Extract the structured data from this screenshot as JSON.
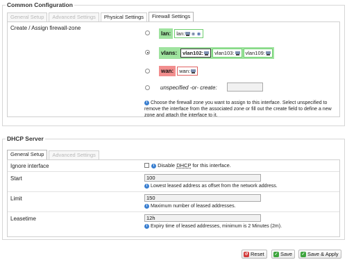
{
  "common": {
    "legend": "Common Configuration",
    "tabs": [
      "General Setup",
      "Advanced Settings",
      "Physical Settings",
      "Firewall Settings"
    ],
    "active_tab": "Firewall Settings",
    "field_label": "Create / Assign firewall-zone",
    "zones": [
      {
        "name": "lan:",
        "nets": [
          "lan:"
        ],
        "selected": false,
        "color": "#9fe39f",
        "border": "#6fcf6f"
      },
      {
        "name": "vlans:",
        "nets": [
          "vlan102:",
          "vlan103:",
          "vlan109:"
        ],
        "selected": true,
        "color": "#9fe39f",
        "border": "#6fcf6f"
      },
      {
        "name": "wan:",
        "nets": [
          "wan:"
        ],
        "selected": false,
        "color": "#f28e8e",
        "border": "#e06262"
      }
    ],
    "unspecified_label": "unspecified -or- create:",
    "create_value": "",
    "help_text": "Choose the firewall zone you want to assign to this interface. Select unspecified to remove the interface from the associated zone or fill out the create field to define a new zone and attach the interface to it."
  },
  "dhcp": {
    "legend": "DHCP Server",
    "tabs": [
      "General Setup",
      "Advanced Settings"
    ],
    "active_tab": "General Setup",
    "ignore": {
      "label": "Ignore interface",
      "checkbox_label_prefix": "Disable",
      "checkbox_label_link": "DHCP",
      "checkbox_label_suffix": "for this interface."
    },
    "start": {
      "label": "Start",
      "value": "100",
      "help": "Lowest leased address as offset from the network address."
    },
    "limit": {
      "label": "Limit",
      "value": "150",
      "help": "Maximum number of leased addresses."
    },
    "leasetime": {
      "label": "Leasetime",
      "value": "12h",
      "help": "Expiry time of leased addresses, minimum is 2 Minutes (2m)."
    }
  },
  "buttons": {
    "reset": "Reset",
    "save": "Save",
    "save_apply": "Save & Apply"
  },
  "colors": {
    "help_icon": "#3a7fd0",
    "reset_icon": "#d23c3c",
    "save_icon": "#3ea53e"
  }
}
